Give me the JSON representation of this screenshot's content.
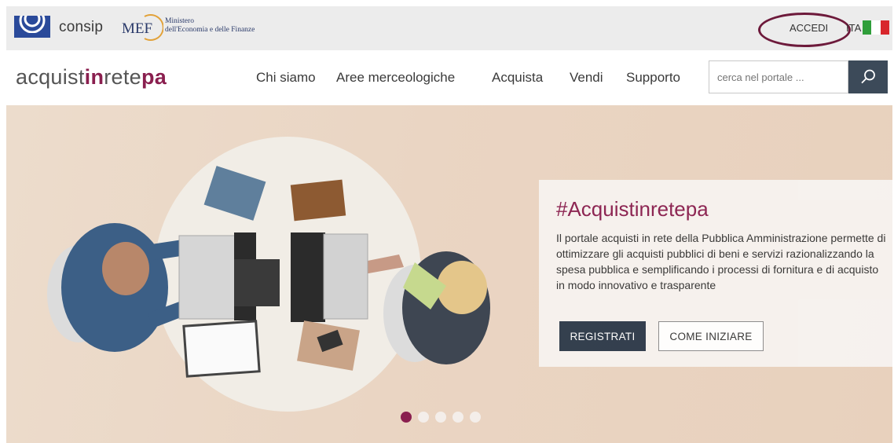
{
  "topbar": {
    "consip_label": "consip",
    "mef_logo_text": "MEF",
    "mef_line1": "Ministero",
    "mef_line2": "dell'Economia e delle Finanze",
    "login_label": "ACCEDI",
    "language_label": "ITA",
    "flag_colors": [
      "#2f9e3a",
      "#ffffff",
      "#d8262c"
    ]
  },
  "navbar": {
    "brand_part1": "acquist",
    "brand_part2": "in",
    "brand_part3": "rete",
    "brand_part4": "pa",
    "items": [
      {
        "label": "Chi siamo"
      },
      {
        "label": "Aree merceologiche"
      },
      {
        "label": "Acquista"
      },
      {
        "label": "Vendi"
      },
      {
        "label": "Supporto"
      }
    ],
    "search": {
      "placeholder": "cerca nel portale ...",
      "icon": "search-icon"
    }
  },
  "hero": {
    "title": "#Acquistinretepa",
    "description": "Il portale acquisti in rete della Pubblica Amministrazione permette di ottimizzare gli acquisti pubblici di beni e servizi razionalizzando la spesa pubblica e semplificando i processi di fornitura e di acquisto in modo innovativo e trasparente",
    "register_label": "REGISTRATI",
    "get_started_label": "COME INIZIARE",
    "carousel": {
      "total": 5,
      "active_index": 0
    }
  },
  "colors": {
    "brand": "#8a1f4f",
    "dark_button": "#2d3a4a",
    "search_button": "#3c4a59",
    "highlight_ring": "#6d1a3b"
  }
}
